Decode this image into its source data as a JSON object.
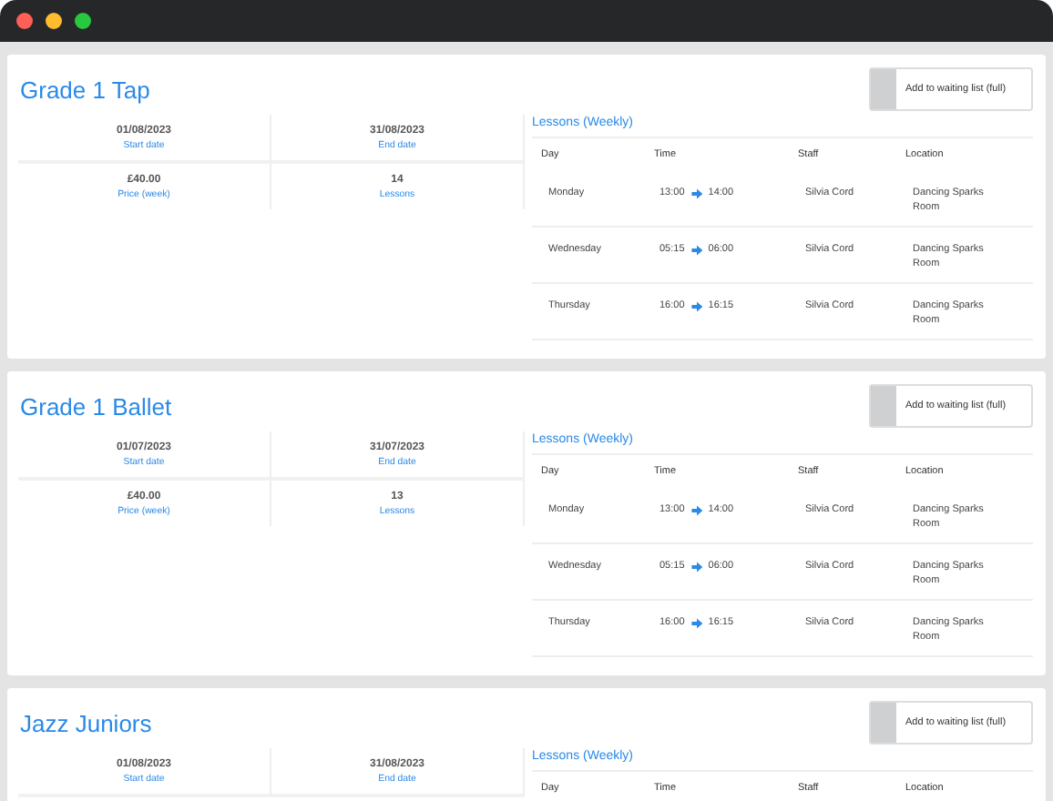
{
  "classes": [
    {
      "title": "Grade 1 Tap",
      "button": "Add to waiting list (full)",
      "stats": [
        {
          "value": "01/08/2023",
          "label": "Start date"
        },
        {
          "value": "31/08/2023",
          "label": "End date"
        },
        {
          "value": "£40.00",
          "label": "Price (week)"
        },
        {
          "value": "14",
          "label": "Lessons"
        }
      ],
      "lessons_title": "Lessons (Weekly)",
      "columns": [
        "Day",
        "Time",
        "Staff",
        "Location"
      ],
      "lessons": [
        {
          "day": "Monday",
          "start": "13:00",
          "end": "14:00",
          "staff": "Silvia Cord",
          "location": "Dancing Sparks Room"
        },
        {
          "day": "Wednesday",
          "start": "05:15",
          "end": "06:00",
          "staff": "Silvia Cord",
          "location": "Dancing Sparks Room"
        },
        {
          "day": "Thursday",
          "start": "16:00",
          "end": "16:15",
          "staff": "Silvia Cord",
          "location": "Dancing Sparks Room"
        }
      ]
    },
    {
      "title": "Grade 1 Ballet",
      "button": "Add to waiting list (full)",
      "stats": [
        {
          "value": "01/07/2023",
          "label": "Start date"
        },
        {
          "value": "31/07/2023",
          "label": "End date"
        },
        {
          "value": "£40.00",
          "label": "Price (week)"
        },
        {
          "value": "13",
          "label": "Lessons"
        }
      ],
      "lessons_title": "Lessons (Weekly)",
      "columns": [
        "Day",
        "Time",
        "Staff",
        "Location"
      ],
      "lessons": [
        {
          "day": "Monday",
          "start": "13:00",
          "end": "14:00",
          "staff": "Silvia Cord",
          "location": "Dancing Sparks Room"
        },
        {
          "day": "Wednesday",
          "start": "05:15",
          "end": "06:00",
          "staff": "Silvia Cord",
          "location": "Dancing Sparks Room"
        },
        {
          "day": "Thursday",
          "start": "16:00",
          "end": "16:15",
          "staff": "Silvia Cord",
          "location": "Dancing Sparks Room"
        }
      ]
    },
    {
      "title": "Jazz Juniors",
      "button": "Add to waiting list (full)",
      "stats": [
        {
          "value": "01/08/2023",
          "label": "Start date"
        },
        {
          "value": "31/08/2023",
          "label": "End date"
        }
      ],
      "lessons_title": "Lessons (Weekly)",
      "columns": [
        "Day",
        "Time",
        "Staff",
        "Location"
      ]
    }
  ]
}
